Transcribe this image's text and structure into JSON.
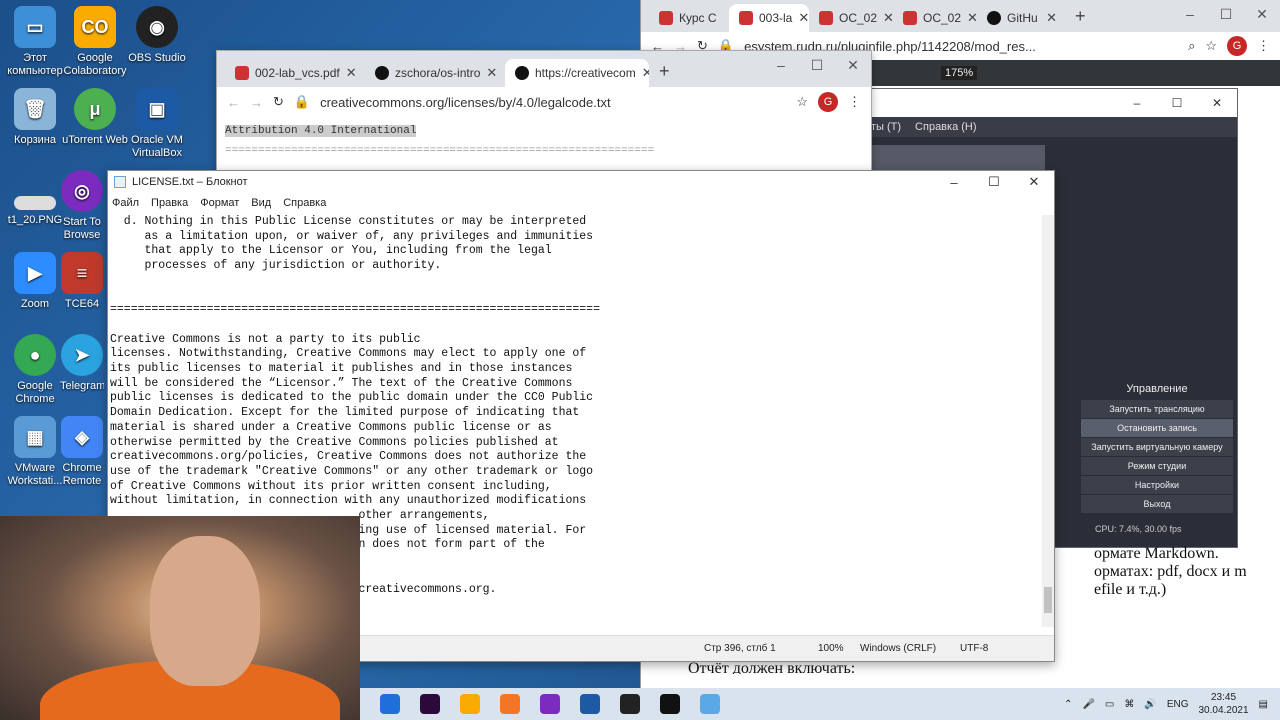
{
  "desktop": {
    "icons": [
      {
        "label": "Этот компьютер",
        "color": "#3d8fd8"
      },
      {
        "label": "Google Colaboratory",
        "color": "#f9ab00"
      },
      {
        "label": "OBS Studio",
        "color": "#222222"
      },
      {
        "label": "Корзина",
        "color": "#8ab4d8"
      },
      {
        "label": "uTorrent Web",
        "color": "#4caf50"
      },
      {
        "label": "Oracle VM VirtualBox",
        "color": "#1c5aa6"
      },
      {
        "label": "t1_20.PNG",
        "color": "#dddddd"
      },
      {
        "label": "Start To Browse",
        "color": "#7b2cbf"
      },
      {
        "label": "Zoom",
        "color": "#2d8cff"
      },
      {
        "label": "TCE64",
        "color": "#c0392b"
      },
      {
        "label": "Google Chrome",
        "color": "#34a853"
      },
      {
        "label": "Telegram",
        "color": "#2aa3e0"
      },
      {
        "label": "VMware Workstati...",
        "color": "#5a9bd5"
      },
      {
        "label": "Chrome Remote",
        "color": "#4285f4"
      }
    ]
  },
  "chrome_right": {
    "tabs": [
      "Курс С",
      "003-la",
      "ОС_02",
      "ОС_02",
      "GitHu"
    ],
    "url": "esystem.rudn.ru/pluginfile.php/1142208/mod_res...",
    "zoom": "175%",
    "avatar": "G"
  },
  "chrome_front": {
    "tabs": [
      "002-lab_vcs.pdf",
      "zschora/os-intro",
      "https://creativecom"
    ],
    "url": "creativecommons.org/licenses/by/4.0/legalcode.txt",
    "avatar": "G",
    "line1": "Attribution 4.0 International",
    "line2": "======================================================================="
  },
  "obs": {
    "menu": [
      "ты (T)",
      "Справка (H)"
    ],
    "panel_title": "Управление",
    "buttons": [
      "Запустить трансляцию",
      "Остановить запись",
      "Запустить виртуальную камеру",
      "Режим студии",
      "Настройки",
      "Выход"
    ],
    "status": "CPU: 7.4%, 30.00 fps"
  },
  "notepad": {
    "title": "LICENSE.txt – Блокнот",
    "menu": [
      "Файл",
      "Правка",
      "Формат",
      "Вид",
      "Справка"
    ],
    "lines": [
      "  d. Nothing in this Public License constitutes or may be interpreted",
      "     as a limitation upon, or waiver of, any privileges and immunities",
      "     that apply to the Licensor or You, including from the legal",
      "     processes of any jurisdiction or authority.",
      "",
      "",
      "=======================================================================",
      "",
      "Creative Commons is not a party to its public",
      "licenses. Notwithstanding, Creative Commons may elect to apply one of",
      "its public licenses to material it publishes and in those instances",
      "will be considered the “Licensor.” The text of the Creative Commons",
      "public licenses is dedicated to the public domain under the CC0 Public",
      "Domain Dedication. Except for the limited purpose of indicating that",
      "material is shared under a Creative Commons public license or as",
      "otherwise permitted by the Creative Commons policies published at",
      "creativecommons.org/policies, Creative Commons does not authorize the",
      "use of the trademark \"Creative Commons\" or any other trademark or logo",
      "of Creative Commons without its prior written consent including,",
      "without limitation, in connection with any unauthorized modifications",
      "                                    other arrangements,",
      "                                    ing use of licensed material. For",
      "                                    n does not form part of the",
      "",
      "",
      "                                    creativecommons.org."
    ],
    "status_pos": "Стр 396, стлб 1",
    "status_zoom": "100%",
    "status_eol": "Windows (CRLF)",
    "status_enc": "UTF-8"
  },
  "docs": {
    "line1": "ормате Markdown.",
    "line2": "орматах: pdf, docx и m",
    "line3": "efile и т.д.)",
    "line4": "Отчёт должен включать:"
  },
  "taskbar": {
    "apps": [
      {
        "name": "mail",
        "color": "#1e6fd9"
      },
      {
        "name": "premiere",
        "color": "#2a0a3a"
      },
      {
        "name": "colab",
        "color": "#f9ab00"
      },
      {
        "name": "jupyter",
        "color": "#f37626"
      },
      {
        "name": "tor",
        "color": "#7b2cbf"
      },
      {
        "name": "virtualbox",
        "color": "#1c5aa6"
      },
      {
        "name": "obs",
        "color": "#222222"
      },
      {
        "name": "terminal",
        "color": "#111111"
      },
      {
        "name": "notepad",
        "color": "#5aa9e6"
      }
    ],
    "lang": "ENG",
    "time": "23:45",
    "date": "30.04.2021"
  }
}
